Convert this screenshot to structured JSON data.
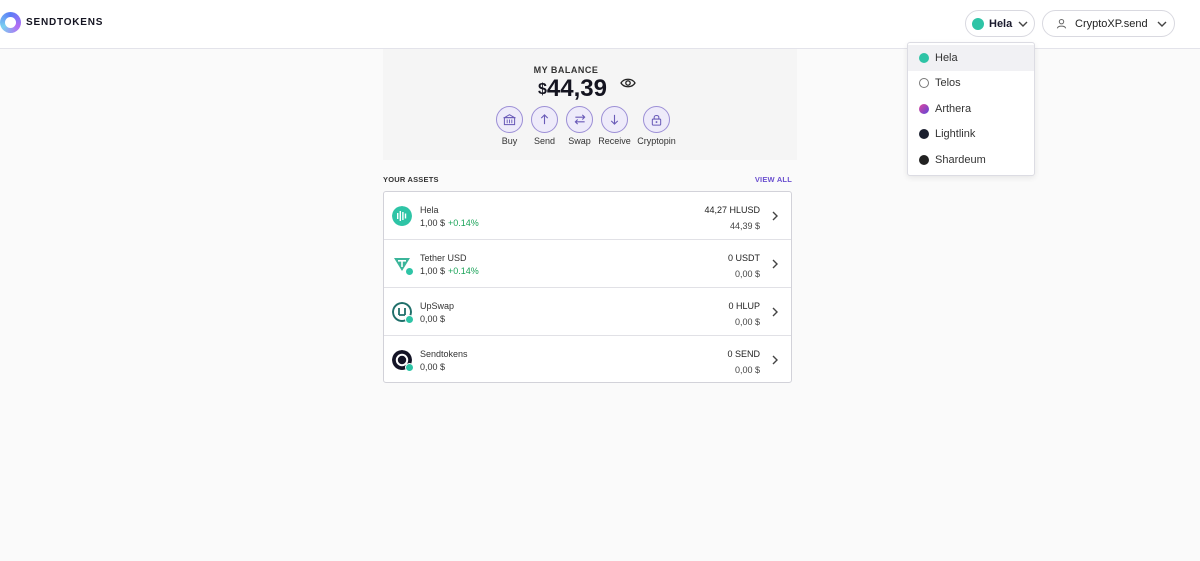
{
  "app": {
    "name": "SENDTOKENS"
  },
  "colors": {
    "accent": "#6a4fcf",
    "positive": "#1ca45a",
    "hela": "#2ec4a6"
  },
  "header": {
    "network": {
      "selected": "Hela",
      "icon": "hela-chain-icon"
    },
    "account": {
      "name": "CryptoXP.send",
      "icon": "user-icon"
    }
  },
  "network_menu": {
    "items": [
      {
        "label": "Hela",
        "icon": "hela-chain-icon",
        "active": true
      },
      {
        "label": "Telos",
        "icon": "telos-chain-icon"
      },
      {
        "label": "Arthera",
        "icon": "arthera-chain-icon"
      },
      {
        "label": "Lightlink",
        "icon": "lightlink-chain-icon"
      },
      {
        "label": "Shardeum",
        "icon": "shardeum-chain-icon"
      }
    ]
  },
  "balance": {
    "label": "MY BALANCE",
    "currency": "$",
    "amount": "44,39",
    "icon": "eye-icon"
  },
  "actions": [
    {
      "label": "Buy",
      "icon": "bank-icon"
    },
    {
      "label": "Send",
      "icon": "arrow-up-icon"
    },
    {
      "label": "Swap",
      "icon": "swap-icon"
    },
    {
      "label": "Receive",
      "icon": "arrow-down-icon"
    },
    {
      "label": "Cryptopin",
      "icon": "lock-pin-icon"
    }
  ],
  "assets": {
    "title": "YOUR ASSETS",
    "view_all": "VIEW ALL",
    "items": [
      {
        "name": "Hela",
        "price": "1,00 $",
        "change": "+0.14%",
        "amount": "44,27 HLUSD",
        "value": "44,39 $",
        "icon": "hela-token-icon"
      },
      {
        "name": "Tether USD",
        "price": "1,00 $",
        "change": "+0.14%",
        "amount": "0 USDT",
        "value": "0,00 $",
        "icon": "tether-token-icon"
      },
      {
        "name": "UpSwap",
        "price": "0,00 $",
        "change": "",
        "amount": "0 HLUP",
        "value": "0,00 $",
        "icon": "upswap-token-icon"
      },
      {
        "name": "Sendtokens",
        "price": "0,00 $",
        "change": "",
        "amount": "0 SEND",
        "value": "0,00 $",
        "icon": "sendtokens-token-icon"
      }
    ]
  }
}
